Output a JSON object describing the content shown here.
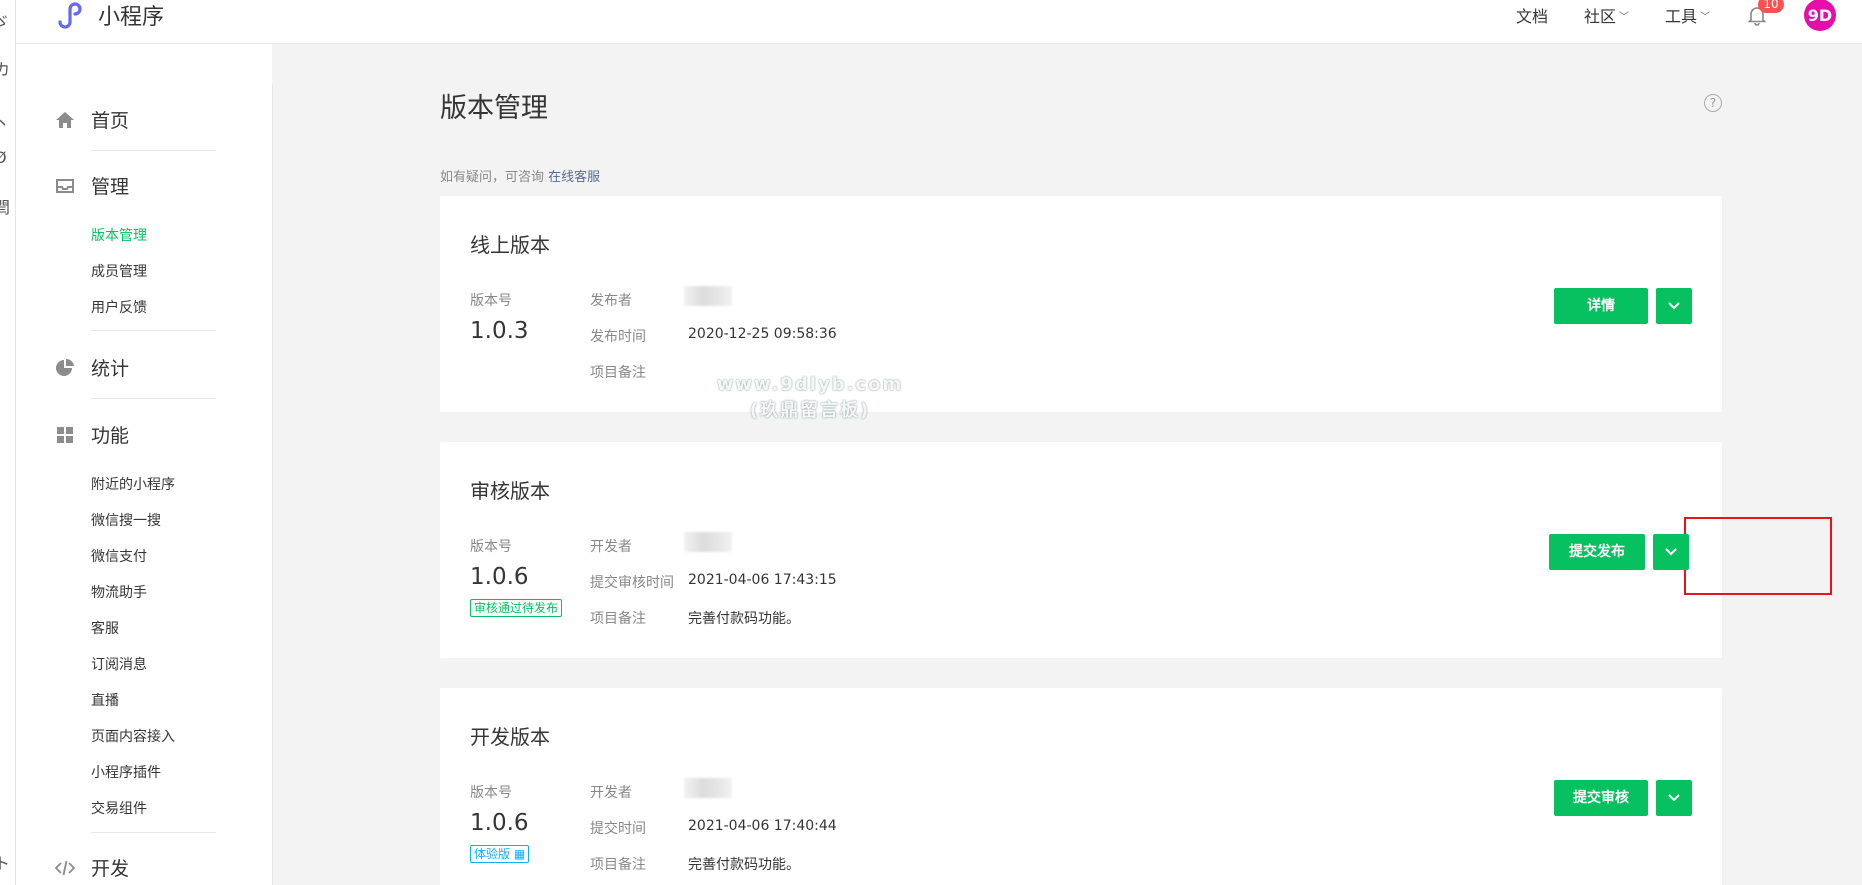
{
  "app": {
    "logo_text": "小程序"
  },
  "left_strip_chars": [
    "ゞ",
    "カ",
    "丶",
    "Ø",
    "閆",
    "ト"
  ],
  "topbar": {
    "docs": "文档",
    "community": "社区",
    "tools": "工具",
    "notification_count": "10",
    "avatar_text": "9D"
  },
  "sidebar": {
    "home": "首页",
    "manage": "管理",
    "manage_items": [
      "版本管理",
      "成员管理",
      "用户反馈"
    ],
    "stats": "统计",
    "features": "功能",
    "feature_items": [
      "附近的小程序",
      "微信搜一搜",
      "微信支付",
      "物流助手",
      "客服",
      "订阅消息",
      "直播",
      "页面内容接入",
      "小程序插件",
      "交易组件"
    ],
    "dev": "开发"
  },
  "main": {
    "title": "版本管理",
    "notice_text": "如有疑问，可咨询",
    "notice_link": "在线客服"
  },
  "online": {
    "title": "线上版本",
    "version_label": "版本号",
    "version": "1.0.3",
    "publisher_label": "发布者",
    "time_label": "发布时间",
    "time": "2020-12-25 09:58:36",
    "remark_label": "项目备注",
    "button": "详情"
  },
  "review": {
    "title": "审核版本",
    "version_label": "版本号",
    "version": "1.0.6",
    "status_tag": "审核通过待发布",
    "developer_label": "开发者",
    "time_label": "提交审核时间",
    "time": "2021-04-06 17:43:15",
    "remark_label": "项目备注",
    "remark": "完善付款码功能。",
    "button": "提交发布"
  },
  "dev": {
    "title": "开发版本",
    "version_label": "版本号",
    "version": "1.0.6",
    "status_tag": "体验版 ▦",
    "developer_label": "开发者",
    "time_label": "提交时间",
    "time": "2021-04-06 17:40:44",
    "remark_label": "项目备注",
    "remark": "完善付款码功能。",
    "button": "提交审核"
  },
  "watermark": {
    "line1": "www.9dlyb.com",
    "line2": "(玖鼎留言板)"
  },
  "colors": {
    "brand_green": "#07c160",
    "highlight_red": "#e8141b",
    "link_blue": "#576b95"
  }
}
